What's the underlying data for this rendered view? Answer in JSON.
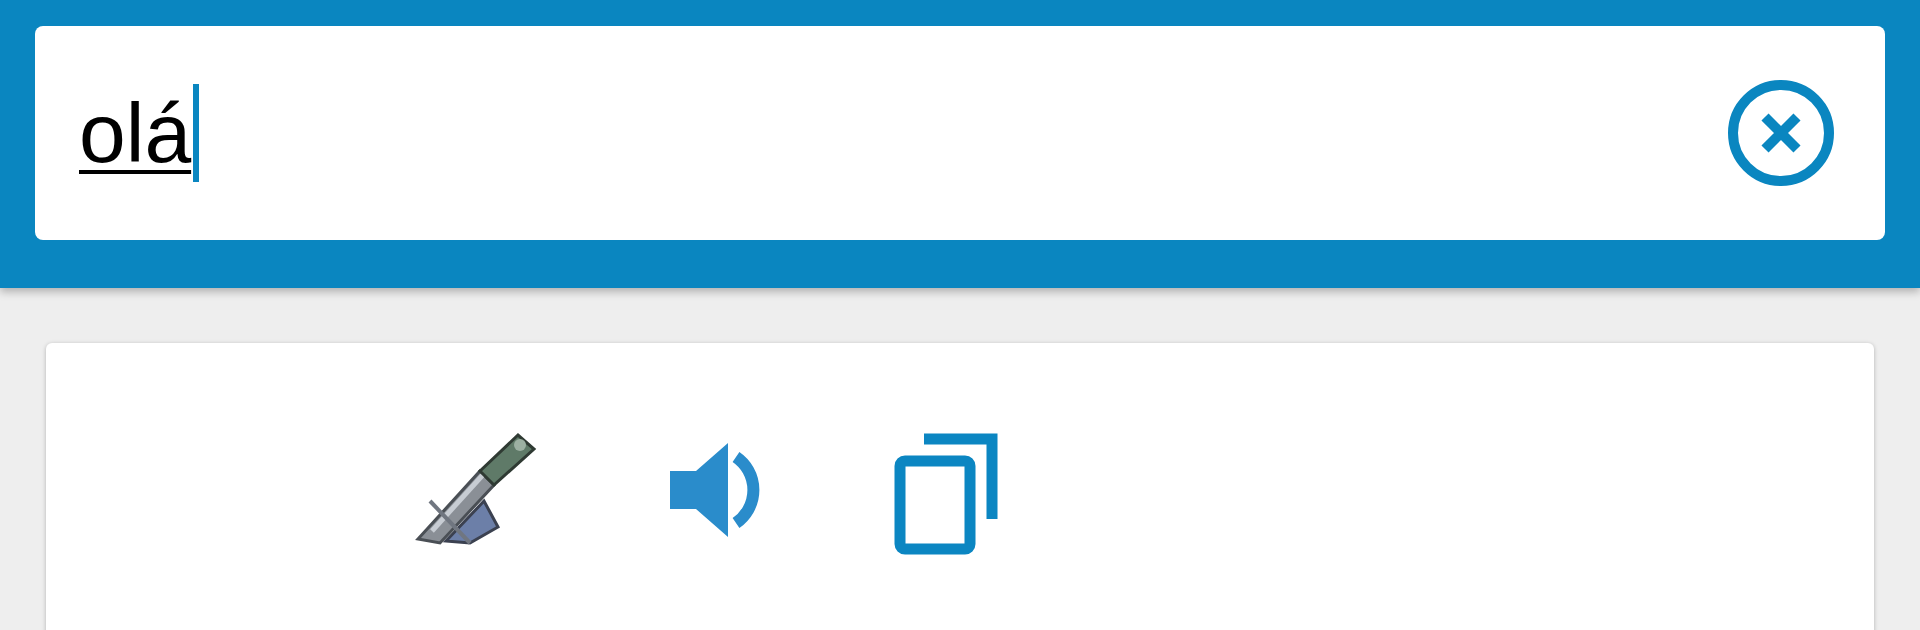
{
  "search": {
    "value": "olá",
    "composing": true
  },
  "result_actions": [
    {
      "kind": "tool"
    },
    {
      "kind": "speaker"
    },
    {
      "kind": "copy"
    }
  ]
}
